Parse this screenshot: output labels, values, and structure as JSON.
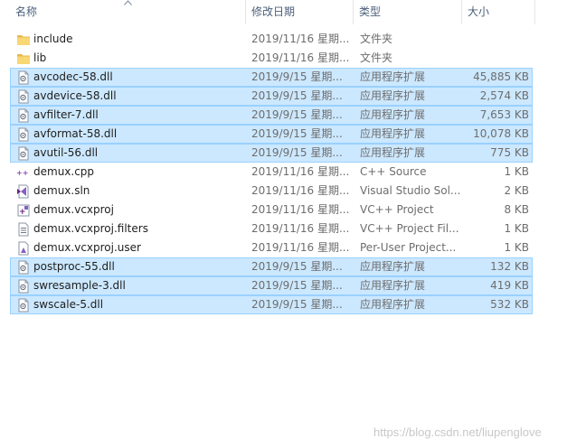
{
  "header": {
    "name": "名称",
    "date": "修改日期",
    "type": "类型",
    "size": "大小"
  },
  "files": [
    {
      "name": "include",
      "date": "2019/11/16 星期...",
      "type": "文件夹",
      "size": "",
      "icon": "folder-icon",
      "selected": false
    },
    {
      "name": "lib",
      "date": "2019/11/16 星期...",
      "type": "文件夹",
      "size": "",
      "icon": "folder-icon",
      "selected": false
    },
    {
      "name": "avcodec-58.dll",
      "date": "2019/9/15 星期...",
      "type": "应用程序扩展",
      "size": "45,885 KB",
      "icon": "dll-icon",
      "selected": true
    },
    {
      "name": "avdevice-58.dll",
      "date": "2019/9/15 星期...",
      "type": "应用程序扩展",
      "size": "2,574 KB",
      "icon": "dll-icon",
      "selected": true
    },
    {
      "name": "avfilter-7.dll",
      "date": "2019/9/15 星期...",
      "type": "应用程序扩展",
      "size": "7,653 KB",
      "icon": "dll-icon",
      "selected": true
    },
    {
      "name": "avformat-58.dll",
      "date": "2019/9/15 星期...",
      "type": "应用程序扩展",
      "size": "10,078 KB",
      "icon": "dll-icon",
      "selected": true
    },
    {
      "name": "avutil-56.dll",
      "date": "2019/9/15 星期...",
      "type": "应用程序扩展",
      "size": "775 KB",
      "icon": "dll-icon",
      "selected": true
    },
    {
      "name": "demux.cpp",
      "date": "2019/11/16 星期...",
      "type": "C++ Source",
      "size": "1 KB",
      "icon": "cpp-icon",
      "selected": false
    },
    {
      "name": "demux.sln",
      "date": "2019/11/16 星期...",
      "type": "Visual Studio Sol...",
      "size": "2 KB",
      "icon": "sln-icon",
      "selected": false
    },
    {
      "name": "demux.vcxproj",
      "date": "2019/11/16 星期...",
      "type": "VC++ Project",
      "size": "8 KB",
      "icon": "vcxproj-icon",
      "selected": false
    },
    {
      "name": "demux.vcxproj.filters",
      "date": "2019/11/16 星期...",
      "type": "VC++ Project Fil...",
      "size": "1 KB",
      "icon": "filters-icon",
      "selected": false
    },
    {
      "name": "demux.vcxproj.user",
      "date": "2019/11/16 星期...",
      "type": "Per-User Project...",
      "size": "1 KB",
      "icon": "user-file-icon",
      "selected": false
    },
    {
      "name": "postproc-55.dll",
      "date": "2019/9/15 星期...",
      "type": "应用程序扩展",
      "size": "132 KB",
      "icon": "dll-icon",
      "selected": true
    },
    {
      "name": "swresample-3.dll",
      "date": "2019/9/15 星期...",
      "type": "应用程序扩展",
      "size": "419 KB",
      "icon": "dll-icon",
      "selected": true
    },
    {
      "name": "swscale-5.dll",
      "date": "2019/9/15 星期...",
      "type": "应用程序扩展",
      "size": "532 KB",
      "icon": "dll-icon",
      "selected": true
    }
  ],
  "watermark": "https://blog.csdn.net/liupenglove",
  "colors": {
    "selection_bg": "#cce8ff",
    "selection_border": "#99d1ff",
    "header_text": "#4c607a",
    "folder": "#f8d775"
  }
}
